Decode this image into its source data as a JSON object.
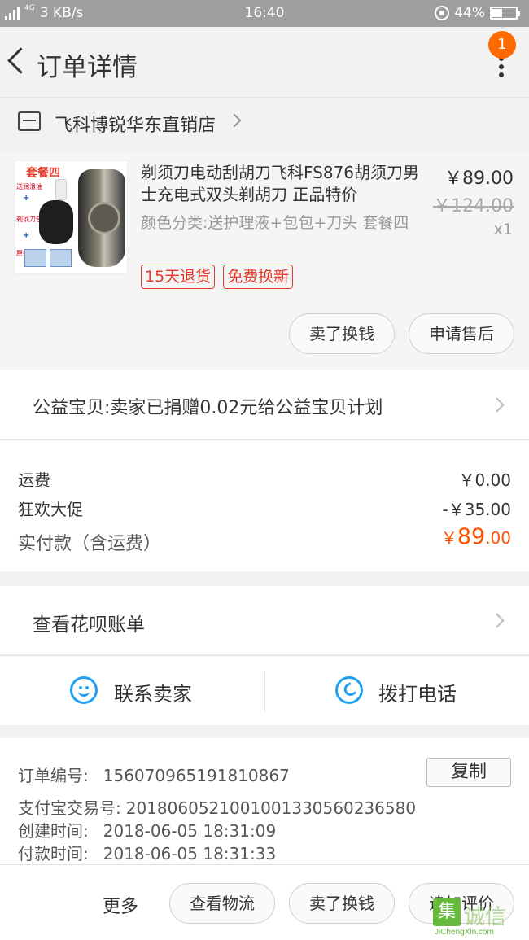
{
  "status_bar": {
    "network": "4G",
    "speed": "3 KB/s",
    "time": "16:40",
    "battery_percent": "44%",
    "battery_level": 0.44
  },
  "nav": {
    "title": "订单详情",
    "badge": "1"
  },
  "store": {
    "name": "飞科博锐华东直销店"
  },
  "product": {
    "thumb_label": "套餐四",
    "thumb_notes": [
      "送润滑油",
      "剃须刀包",
      "原装刀头"
    ],
    "title": "剃须刀电动刮胡刀飞科FS876胡须刀男士充电式双头剃胡刀 正品特价",
    "variant": "颜色分类:送护理液+包包+刀头 套餐四",
    "price": "￥89.00",
    "original_price": "￥124.00",
    "qty": "x1",
    "tags": [
      "15天退货",
      "免费换新"
    ],
    "actions": [
      "卖了换钱",
      "申请售后"
    ]
  },
  "charity": {
    "text": "公益宝贝:卖家已捐赠0.02元给公益宝贝计划"
  },
  "fees": {
    "shipping_label": "运费",
    "shipping_value": "￥0.00",
    "promo_label": "狂欢大促",
    "promo_value": "-￥35.00",
    "total_label": "实付款（含运费）",
    "total_currency": "￥",
    "total_int": "89",
    "total_dec": ".00"
  },
  "huabei": {
    "text": "查看花呗账单"
  },
  "contact": {
    "seller": "联系卖家",
    "call": "拨打电话"
  },
  "order_info": {
    "order_no_label": "订单编号:",
    "order_no": "156070965191810867",
    "copy": "复制",
    "alipay_label": "支付宝交易号:",
    "alipay_no": "2018060521001001330560236580",
    "created_label": "创建时间:",
    "created": "2018-06-05 18:31:09",
    "paid_label": "付款时间:",
    "paid": "2018-06-05 18:31:33"
  },
  "footer": {
    "more": "更多",
    "buttons": [
      "查看物流",
      "卖了换钱",
      "追加评价"
    ]
  },
  "watermark": {
    "glyph": "集",
    "text": "诚信",
    "url": "JiChengXin.com"
  }
}
